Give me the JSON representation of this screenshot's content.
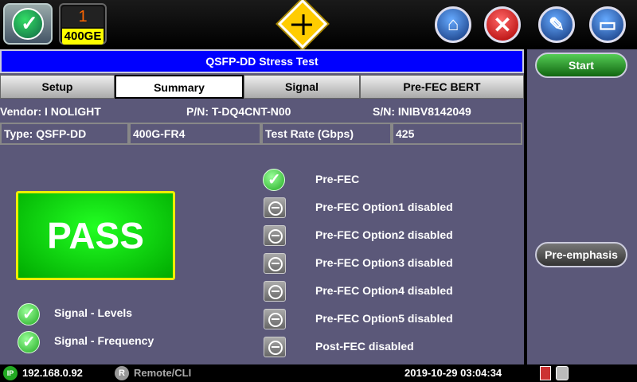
{
  "topbar": {
    "port_number": "1",
    "port_rate": "400GE"
  },
  "title": "QSFP-DD Stress Test",
  "tabs": [
    {
      "label": "Setup"
    },
    {
      "label": "Summary"
    },
    {
      "label": "Signal"
    },
    {
      "label": "Pre-FEC BERT"
    }
  ],
  "info": {
    "vendor": "Vendor: I NOLIGHT",
    "pn": "P/N: T-DQ4CNT-N00",
    "sn": "S/N: INIBV8142049"
  },
  "type_row": {
    "type": "Type: QSFP-DD",
    "variant": "400G-FR4",
    "rate_label": "Test Rate (Gbps)",
    "rate_value": "425"
  },
  "result": "PASS",
  "signal_checks": [
    {
      "label": "Signal - Levels",
      "icon": "check-icon"
    },
    {
      "label": "Signal - Frequency",
      "icon": "check-icon"
    }
  ],
  "fec_items": [
    {
      "label": "Pre-FEC",
      "icon": "check-icon"
    },
    {
      "label": "Pre-FEC Option1 disabled",
      "icon": "disabled-icon"
    },
    {
      "label": "Pre-FEC Option2 disabled",
      "icon": "disabled-icon"
    },
    {
      "label": "Pre-FEC Option3 disabled",
      "icon": "disabled-icon"
    },
    {
      "label": "Pre-FEC Option4 disabled",
      "icon": "disabled-icon"
    },
    {
      "label": "Pre-FEC Option5 disabled",
      "icon": "disabled-icon"
    },
    {
      "label": "Post-FEC disabled",
      "icon": "disabled-icon"
    }
  ],
  "side": {
    "start_label": "Start",
    "preemphasis_label": "Pre-emphasis"
  },
  "status": {
    "ip_badge": "IP",
    "ip": "192.168.0.92",
    "remote_badge": "R",
    "remote": "Remote/CLI",
    "datetime": "2019-10-29  03:04:34"
  },
  "colors": {
    "title_bar": "#0000ff",
    "panel": "#5b5879",
    "pass": "#11cc11"
  }
}
